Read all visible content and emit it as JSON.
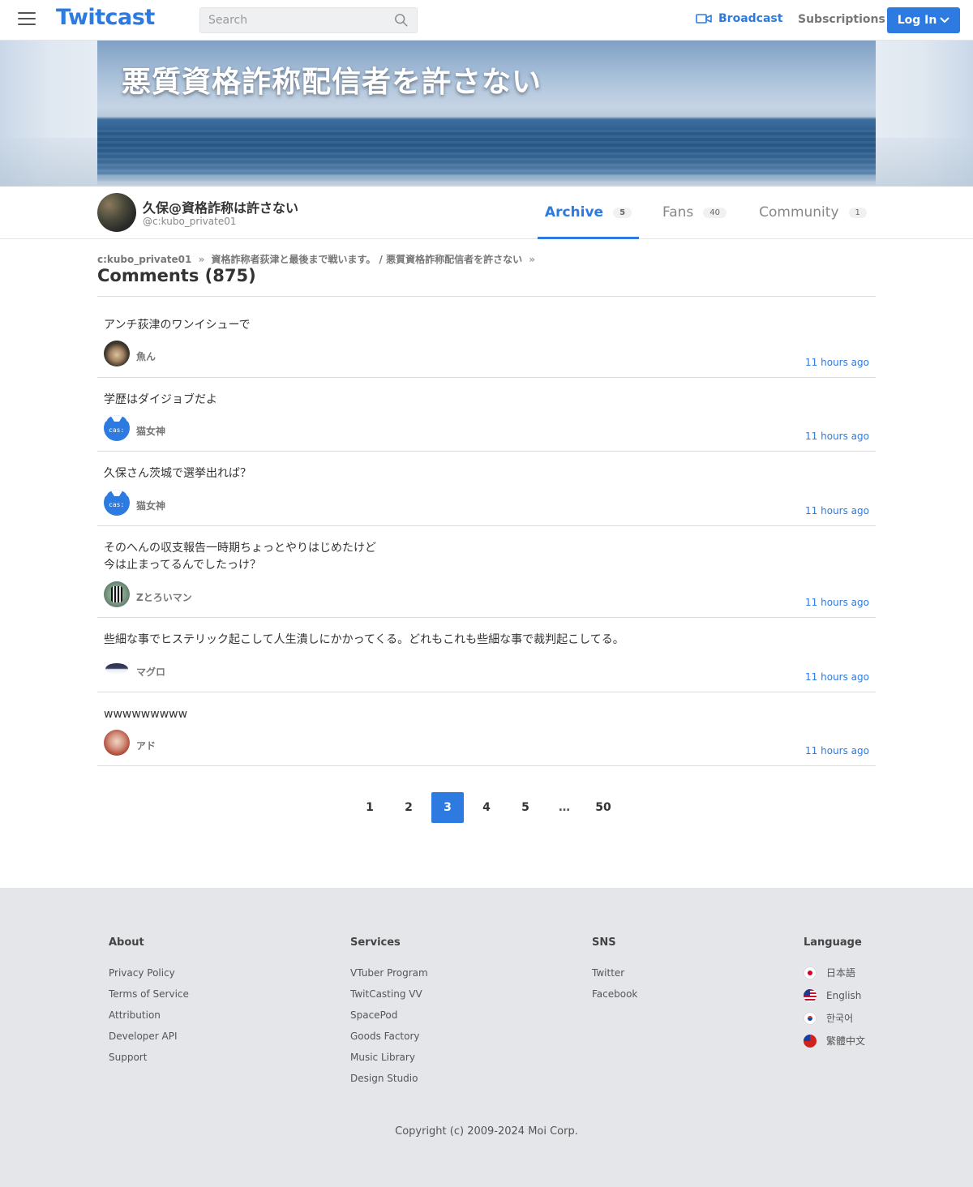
{
  "header": {
    "logo": "Twitcast",
    "search_placeholder": "Search",
    "broadcast_label": "Broadcast",
    "subscriptions_label": "Subscriptions",
    "login_label": "Log In",
    "accent_color": "#2d7be0"
  },
  "banner": {
    "title": "悪質資格詐称配信者を許さない"
  },
  "profile": {
    "name": "久保@資格詐称は許さない",
    "id": "@c:kubo_private01",
    "tabs": [
      {
        "label": "Archive",
        "count": "5"
      },
      {
        "label": "Fans",
        "count": "40"
      },
      {
        "label": "Community",
        "count": "1"
      }
    ]
  },
  "breadcrumb": {
    "items": [
      "c:kubo_private01",
      "資格詐称者荻津と最後まで戦います。 / 悪質資格詐称配信者を許さない"
    ],
    "separator": "»"
  },
  "page": {
    "title": "Comments (875)"
  },
  "comments": [
    {
      "text": "アンチ荻津のワンイシューで",
      "user": "魚ん",
      "time": "11 hours ago",
      "avatar": "fish-avatar"
    },
    {
      "text": "学歴はダイジョブだよ",
      "user": "猫女神",
      "time": "11 hours ago",
      "avatar": "cas-avatar"
    },
    {
      "text": "久保さん茨城で選挙出れば？",
      "user": "猫女神",
      "time": "11 hours ago",
      "avatar": "cas-avatar"
    },
    {
      "text": "そのへんの収支報告一時期ちょっとやりはじめたけど\n今は止まってるんでしたっけ？",
      "user": "Zとろいマン",
      "time": "11 hours ago",
      "avatar": "zebra-avatar"
    },
    {
      "text": "些細な事でヒステリック起こして人生潰しにかかってくる。どれもこれも些細な事で裁判起こしてる。",
      "user": "マグロ",
      "time": "11 hours ago",
      "avatar": "tuna-avatar"
    },
    {
      "text": "wwwwwwwww",
      "user": "アド",
      "time": "11 hours ago",
      "avatar": "ado-avatar"
    }
  ],
  "pagination": {
    "pages": [
      "1",
      "2",
      "3",
      "4",
      "5",
      "…",
      "50"
    ],
    "current": "3"
  },
  "footer": {
    "about": {
      "heading": "About",
      "links": [
        "Privacy Policy",
        "Terms of Service",
        "Attribution",
        "Developer API",
        "Support"
      ]
    },
    "services": {
      "heading": "Services",
      "links": [
        "VTuber Program",
        "TwitCasting VV",
        "SpacePod",
        "Goods Factory",
        "Music Library",
        "Design Studio"
      ]
    },
    "sns": {
      "heading": "SNS",
      "links": [
        "Twitter",
        "Facebook"
      ]
    },
    "language": {
      "heading": "Language",
      "items": [
        "日本語",
        "English",
        "한국어",
        "繁體中文"
      ]
    },
    "copyright": "Copyright (c) 2009-2024 Moi Corp."
  }
}
